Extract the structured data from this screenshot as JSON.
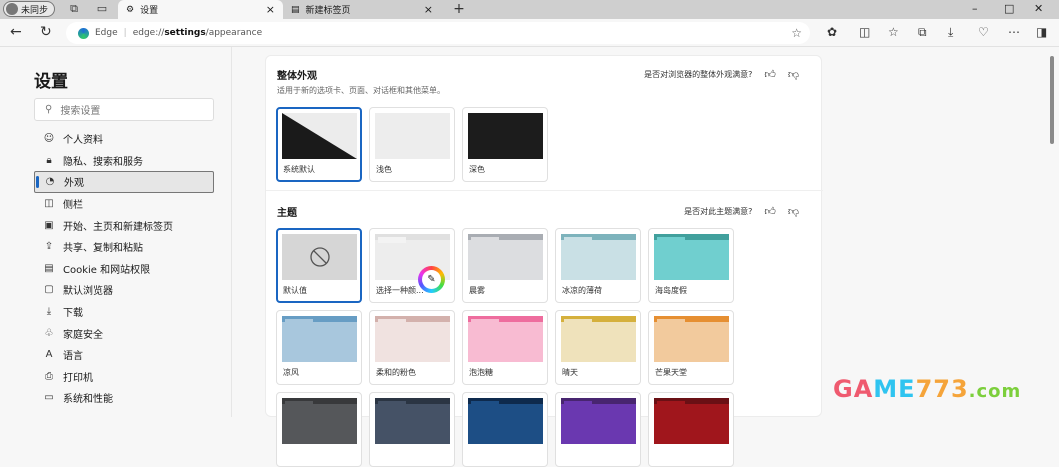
{
  "tabbar": {
    "profile": "未同步",
    "tabs": [
      {
        "label": "设置",
        "active": true
      },
      {
        "label": "新建标签页",
        "active": false
      }
    ],
    "new_tab": "+"
  },
  "toolbar": {
    "site": "Edge",
    "url_prefix": "edge://",
    "url_bold": "settings",
    "url_suffix": "/appearance"
  },
  "sidebar": {
    "title": "设置",
    "search_placeholder": "搜索设置",
    "items": [
      {
        "label": "个人资料",
        "icon": "☺"
      },
      {
        "label": "隐私、搜索和服务",
        "icon": "🔒︎"
      },
      {
        "label": "外观",
        "icon": "◔"
      },
      {
        "label": "侧栏",
        "icon": "◫"
      },
      {
        "label": "开始、主页和新建标签页",
        "icon": "▣"
      },
      {
        "label": "共享、复制和粘贴",
        "icon": "⇪"
      },
      {
        "label": "Cookie 和网站权限",
        "icon": "▤"
      },
      {
        "label": "默认浏览器",
        "icon": "▢"
      },
      {
        "label": "下载",
        "icon": "⤓"
      },
      {
        "label": "家庭安全",
        "icon": "♧"
      },
      {
        "label": "语言",
        "icon": "A"
      },
      {
        "label": "打印机",
        "icon": "⎙"
      },
      {
        "label": "系统和性能",
        "icon": "▭"
      }
    ],
    "selected": "外观"
  },
  "appearance": {
    "title": "整体外观",
    "subtitle": "适用于新的选项卡、页面、对话框和其他菜单。",
    "feedback": "是否对浏览器的整体外观满意?",
    "options": [
      {
        "label": "系统默认",
        "selected": true
      },
      {
        "label": "浅色"
      },
      {
        "label": "深色"
      }
    ]
  },
  "theme": {
    "title": "主题",
    "feedback": "是否对此主题满意?",
    "options": [
      {
        "label": "默认值",
        "selected": true,
        "top": "#d6d6d6",
        "body": "#d6d6d6",
        "tab": "#d6d6d6"
      },
      {
        "label": "选择一种颜...",
        "top": "#e0e0e0",
        "body": "#ededed",
        "tab": "#f3f3f3"
      },
      {
        "label": "晨雾",
        "top": "#a9adb3",
        "body": "#dcdde0",
        "tab": "#dcdde0"
      },
      {
        "label": "冰凉的薄荷",
        "top": "#7db3bc",
        "body": "#c9e0e5",
        "tab": "#c9e0e5"
      },
      {
        "label": "海岛度假",
        "top": "#41a09d",
        "body": "#70cfcf",
        "tab": "#70cfcf"
      },
      {
        "label": "凉风",
        "top": "#679dc4",
        "body": "#a8c7dd",
        "tab": "#a8c7dd"
      },
      {
        "label": "柔和的粉色",
        "top": "#d3b1ac",
        "body": "#f0e2e0",
        "tab": "#f0e2e0"
      },
      {
        "label": "泡泡糖",
        "top": "#ee6d9e",
        "body": "#f8bbd2",
        "tab": "#f8bbd2"
      },
      {
        "label": "晴天",
        "top": "#d5b03c",
        "body": "#efe2bb",
        "tab": "#efe2bb"
      },
      {
        "label": "芒果天堂",
        "top": "#e68f32",
        "body": "#f2ca9d",
        "tab": "#f2ca9d"
      },
      {
        "label": "",
        "top": "#38393b",
        "body": "#55575a",
        "tab": "#55575a"
      },
      {
        "label": "",
        "top": "#2b3543",
        "body": "#455266",
        "tab": "#455266"
      },
      {
        "label": "",
        "top": "#0e2a4d",
        "body": "#1d4e85",
        "tab": "#1d4e85"
      },
      {
        "label": "",
        "top": "#482570",
        "body": "#6a38b0",
        "tab": "#6a38b0"
      },
      {
        "label": "",
        "top": "#6a1015",
        "body": "#a0161c",
        "tab": "#a0161c"
      }
    ]
  },
  "watermark": "GAME773.com"
}
